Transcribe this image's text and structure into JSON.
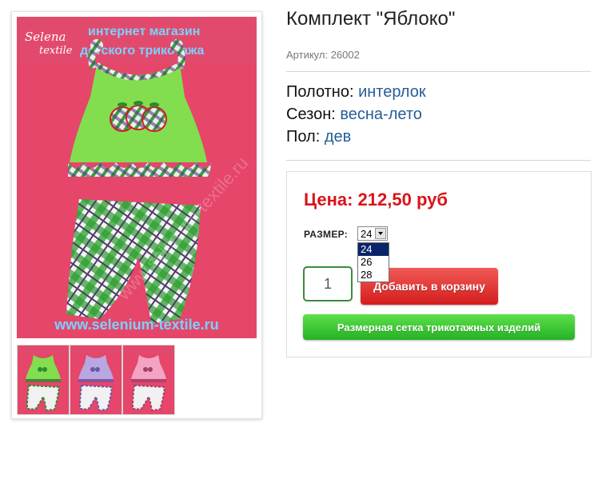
{
  "product": {
    "title": "Комплект \"Яблоко\"",
    "sku": "Артикул: 26002",
    "attributes": [
      {
        "label": "Полотно:",
        "value": "интерлок"
      },
      {
        "label": "Сезон:",
        "value": "весна-лето"
      },
      {
        "label": "Пол:",
        "value": "дев"
      }
    ]
  },
  "image": {
    "shop_name_line1": "интернет магазин",
    "shop_name_line2": "детского трикотажа",
    "logo_text_1": "Selena",
    "logo_text_2": "textile",
    "watermark": "www.selenium-textile.ru",
    "url_caption": "www.selenium-textile.ru"
  },
  "thumbnails": [
    {
      "name": "green",
      "shirt_color": "#82de4e",
      "accent": "#2f8b2f"
    },
    {
      "name": "lilac",
      "shirt_color": "#b9a7e3",
      "accent": "#6b58a8"
    },
    {
      "name": "pink",
      "shirt_color": "#f4a3c4",
      "accent": "#a0416b"
    }
  ],
  "purchase": {
    "price": "Цена: 212,50 руб",
    "size_label": "РАЗМЕР:",
    "selected_size": "24",
    "size_options": [
      "24",
      "26",
      "28"
    ],
    "quantity": "1",
    "add_to_cart": "Добавить в корзину",
    "size_chart": "Размерная сетка трикотажных изделий"
  },
  "colors": {
    "price": "#d8141b",
    "attribute_value": "#255d97",
    "cart_button": "#e33a36",
    "size_chart_button": "#3ec93a",
    "photo_background": "#e5466a"
  }
}
